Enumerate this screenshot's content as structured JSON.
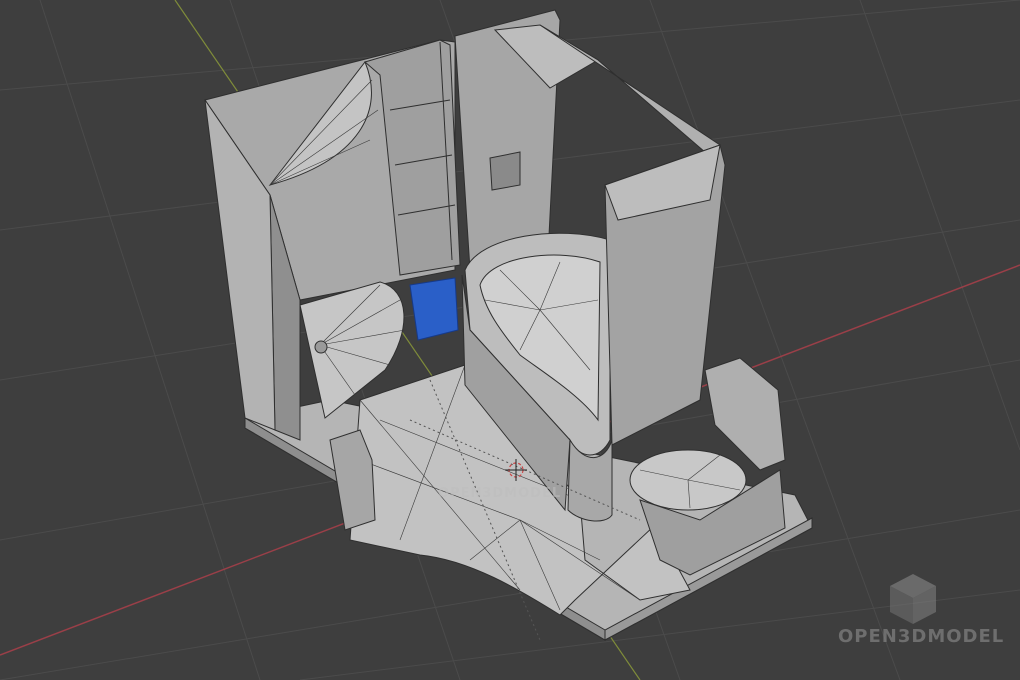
{
  "viewport": {
    "background_color": "#3e3e3e",
    "grid_color": "#4a4a4a",
    "axis_x_color": "#a0404a",
    "axis_y_color": "#8a9a40"
  },
  "model": {
    "name": "bathroom",
    "mesh_color": "#b8b8b8",
    "wire_color": "#3a3a3a",
    "selected_object_color": "#2a5fc8",
    "origin_marker": "3d-cursor-icon"
  },
  "watermark": {
    "inline_text": "OPEN3DMODEL",
    "brand_text": "OPEN3DMODEL",
    "logo_icon": "cube-logo-icon"
  }
}
